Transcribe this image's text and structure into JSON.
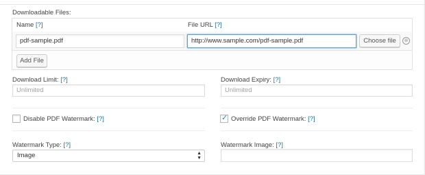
{
  "downloadable_files": {
    "section_label": "Downloadable Files:",
    "name_header": "Name",
    "file_url_header": "File URL",
    "help_mark": "[?]",
    "rows": [
      {
        "name": "pdf-sample.pdf",
        "url": "http://www.sample.com/pdf-sample.pdf"
      }
    ],
    "choose_file_label": "Choose file",
    "add_file_label": "Add File",
    "remove_icon": "⊗"
  },
  "download_limit": {
    "label": "Download Limit:",
    "help": "[?]",
    "placeholder": "Unlimited"
  },
  "download_expiry": {
    "label": "Download Expiry:",
    "help": "[?]",
    "placeholder": "Unlimited"
  },
  "disable_pdf_watermark": {
    "label": "Disable PDF Watermark:",
    "help": "[?]",
    "checked": false
  },
  "override_pdf_watermark": {
    "label": "Override PDF Watermark:",
    "help": "[?]",
    "checked": true,
    "check_glyph": "✓"
  },
  "watermark_type": {
    "label": "Watermark Type:",
    "help": "[?]",
    "selected": "Image",
    "arrows_icon": "▲▼"
  },
  "watermark_image": {
    "label": "Watermark Image:",
    "help": "[?]",
    "value": ""
  },
  "colors": {
    "link": "#21759b",
    "focus": "#5b9dd9",
    "accent": "#1e8cbe"
  }
}
